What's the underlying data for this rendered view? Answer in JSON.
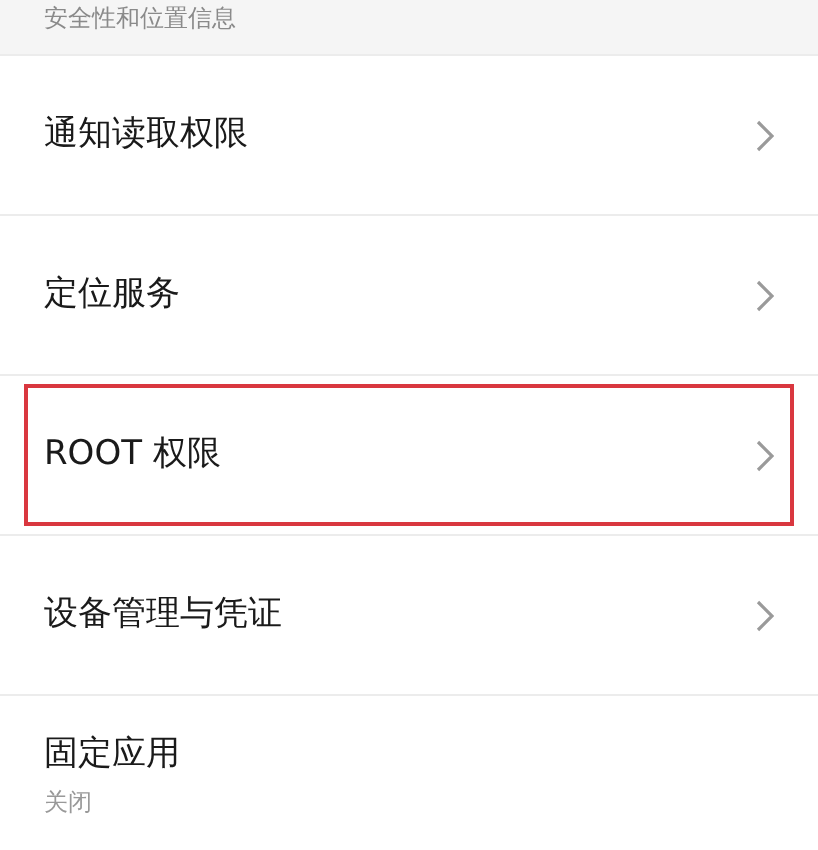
{
  "section_header": "安全性和位置信息",
  "items": [
    {
      "label": "通知读取权限",
      "chevron": true,
      "highlighted": false
    },
    {
      "label": "定位服务",
      "chevron": true,
      "highlighted": false
    },
    {
      "label": "ROOT 权限",
      "chevron": true,
      "highlighted": true
    },
    {
      "label": "设备管理与凭证",
      "chevron": true,
      "highlighted": false
    },
    {
      "label": "固定应用",
      "value": "关闭",
      "chevron": false,
      "highlighted": false
    }
  ]
}
